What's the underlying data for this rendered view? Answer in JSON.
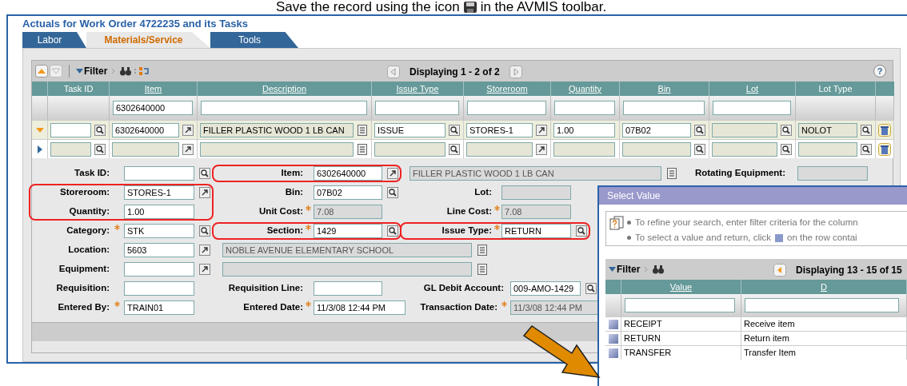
{
  "caption": {
    "before": "Save the record using the icon",
    "after": "in the AVMIS toolbar."
  },
  "window": {
    "title": "Actuals for Work Order 4722235 and its Tasks"
  },
  "tabs": [
    {
      "label": "Labor",
      "selected": false
    },
    {
      "label": "Materials/Service",
      "selected": true
    },
    {
      "label": "Tools",
      "selected": false
    }
  ],
  "table": {
    "toolbar": {
      "filter": "Filter",
      "paging": "Displaying 1 - 2 of 2",
      "help": "?"
    },
    "columns": [
      {
        "label": "Task ID",
        "sortable": false
      },
      {
        "label": "Item",
        "sortable": true
      },
      {
        "label": "Description",
        "sortable": true
      },
      {
        "label": "Issue Type",
        "sortable": true
      },
      {
        "label": "Storeroom",
        "sortable": true
      },
      {
        "label": "Quantity",
        "sortable": true
      },
      {
        "label": "Bin",
        "sortable": true
      },
      {
        "label": "Lot",
        "sortable": true
      },
      {
        "label": "Lot Type",
        "sortable": false
      }
    ],
    "filter_row": [
      {
        "field": false
      },
      {
        "field": true,
        "value": "6302640000"
      },
      {
        "field": true
      },
      {
        "field": true
      },
      {
        "field": true
      },
      {
        "field": true
      },
      {
        "field": true
      },
      {
        "field": true
      },
      {
        "field": false
      }
    ],
    "rows": [
      {
        "selected": true,
        "deletable": true,
        "cells": [
          {
            "editable": true,
            "kind": "lookup"
          },
          {
            "value": "6302640000",
            "editable": true,
            "kind": "detail"
          },
          {
            "value": "FILLER PLASTIC WOOD 1 LB CAN",
            "editable": false,
            "kind": "longdesc"
          },
          {
            "value": "ISSUE",
            "editable": true,
            "kind": "lookup"
          },
          {
            "value": "STORES-1",
            "editable": true,
            "kind": "detail"
          },
          {
            "value": "1.00",
            "editable": true,
            "kind": "plain"
          },
          {
            "value": "07B02",
            "editable": true,
            "kind": "lookup"
          },
          {
            "editable": false,
            "kind": "lookup"
          },
          {
            "value": "NOLOT",
            "editable": false,
            "kind": "lookup"
          }
        ]
      },
      {
        "selected": false,
        "deletable": true,
        "cells": [
          {
            "editable": false,
            "kind": "lookup"
          },
          {
            "editable": false,
            "kind": "detail"
          },
          {
            "editable": false,
            "kind": "longdesc"
          },
          {
            "editable": false,
            "kind": "lookup"
          },
          {
            "editable": false,
            "kind": "detail"
          },
          {
            "editable": false,
            "kind": "plain"
          },
          {
            "editable": false,
            "kind": "lookup"
          },
          {
            "editable": false,
            "kind": "lookup"
          },
          {
            "editable": false,
            "kind": "lookup"
          }
        ]
      }
    ]
  },
  "form": {
    "rows": [
      [
        {
          "label": "Task ID:",
          "required": false,
          "editable": true,
          "kind": "lookup",
          "highlighted": false
        },
        {
          "label": "Item:",
          "required": false,
          "value": "6302640000",
          "editable": true,
          "kind": "detail",
          "highlighted": true
        },
        {
          "value": "FILLER PLASTIC WOOD 1 LB CAN",
          "required": false,
          "editable": false,
          "kind": "longdesc",
          "highlighted": false
        },
        {
          "label": "Rotating Equipment:",
          "required": false,
          "editable": false,
          "kind": "plain",
          "highlighted": false
        }
      ],
      [
        {
          "label": "Storeroom:",
          "required": false,
          "value": "STORES-1",
          "editable": true,
          "kind": "detail",
          "highlighted": true
        },
        {
          "label": "Bin:",
          "required": false,
          "value": "07B02",
          "editable": true,
          "kind": "lookup",
          "highlighted": false
        },
        {
          "label": "Lot:",
          "required": false,
          "editable": false,
          "kind": "plain",
          "highlighted": false
        }
      ],
      [
        {
          "label": "Quantity:",
          "required": false,
          "value": "1.00",
          "editable": true,
          "kind": "plain",
          "highlighted": true
        },
        {
          "label": "Unit Cost:",
          "required": true,
          "value": "7.08",
          "editable": false,
          "kind": "plain",
          "highlighted": false
        },
        {
          "label": "Line Cost:",
          "required": true,
          "value": "7.08",
          "editable": false,
          "kind": "plain",
          "highlighted": false
        }
      ],
      [
        {
          "label": "Category:",
          "required": true,
          "value": "STK",
          "editable": true,
          "kind": "lookup",
          "highlighted": false
        },
        {
          "label": "Section:",
          "required": true,
          "value": "1429",
          "editable": true,
          "kind": "lookup",
          "highlighted": true
        },
        {
          "label": "Issue Type:",
          "required": true,
          "value": "RETURN",
          "editable": true,
          "kind": "lookup",
          "highlighted": true
        }
      ],
      [
        {
          "label": "Location:",
          "required": false,
          "value": "5603",
          "editable": true,
          "kind": "detail",
          "highlighted": false
        },
        {
          "value": "NOBLE AVENUE ELEMENTARY SCHOOL",
          "required": false,
          "editable": false,
          "kind": "longdesc",
          "highlighted": false
        }
      ],
      [
        {
          "label": "Equipment:",
          "required": false,
          "editable": true,
          "kind": "detail",
          "highlighted": false
        },
        {
          "required": false,
          "editable": false,
          "kind": "longdesc",
          "highlighted": false
        }
      ],
      [
        {
          "label": "Requisition:",
          "required": false,
          "editable": true,
          "kind": "plain",
          "highlighted": false
        },
        {
          "label": "Requisition Line:",
          "required": false,
          "editable": true,
          "kind": "plain",
          "highlighted": false
        },
        {
          "label": "GL Debit Account:",
          "required": false,
          "value": "009-AMO-1429",
          "editable": true,
          "kind": "lookup",
          "highlighted": false
        }
      ],
      [
        {
          "label": "Entered By:",
          "required": true,
          "value": "TRAIN01",
          "editable": true,
          "kind": "plain",
          "highlighted": false
        },
        {
          "label": "Entered Date:",
          "required": true,
          "value": "11/3/08 12:44 PM",
          "editable": true,
          "kind": "plain",
          "highlighted": false
        },
        {
          "label": "Transaction Date:",
          "required": true,
          "value": "11/3/08 12:44 PM",
          "editable": false,
          "kind": "plain",
          "highlighted": false
        }
      ]
    ]
  },
  "callout_arrow": true,
  "popup": {
    "title": "Select Value",
    "hints": [
      {
        "before": "To refine your search, enter filter criteria for the column",
        "icon": false
      },
      {
        "before": "To select a value and return, click",
        "icon": true,
        "after": "on the row contai"
      }
    ],
    "toolbar": {
      "filter": "Filter",
      "paging": "Displaying 13 - 15 of 15"
    },
    "columns": [
      {
        "label": "Value"
      },
      {
        "label": "D"
      }
    ],
    "rows": [
      {
        "value": "RECEIPT",
        "description": "Receive item"
      },
      {
        "value": "RETURN",
        "description": "Return item"
      },
      {
        "value": "TRANSFER",
        "description": "Transfer Item"
      }
    ]
  }
}
